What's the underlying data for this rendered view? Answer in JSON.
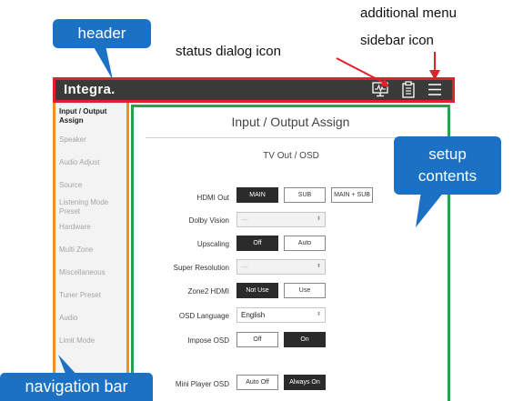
{
  "annotations": {
    "header": "header",
    "status_dialog_icon": "status dialog icon",
    "additional_menu_line1": "additional menu",
    "additional_menu_line2": "sidebar icon",
    "setup_line1": "setup",
    "setup_line2": "contents",
    "navigation_bar": "navigation bar"
  },
  "app": {
    "logo": "Integra."
  },
  "sidebar": {
    "items": [
      {
        "label": "Input / Output Assign",
        "active": true
      },
      {
        "label": "Speaker"
      },
      {
        "label": "Audio Adjust"
      },
      {
        "label": "Source"
      },
      {
        "label": "Listening Mode Preset"
      },
      {
        "label": "Hardware"
      },
      {
        "label": "Multi Zone"
      },
      {
        "label": "Miscellaneous"
      },
      {
        "label": "Tuner Preset"
      },
      {
        "label": "Audio"
      },
      {
        "label": "Limit Mode"
      }
    ]
  },
  "main": {
    "title": "Input / Output Assign",
    "section": "TV Out / OSD",
    "rows": {
      "hdmi_out": {
        "label": "HDMI Out",
        "options": [
          "MAIN",
          "SUB",
          "MAIN + SUB"
        ],
        "selected": "MAIN"
      },
      "dolby_vision": {
        "label": "Dolby Vision",
        "value": "---"
      },
      "upscaling": {
        "label": "Upscaling",
        "options": [
          "Off",
          "Auto"
        ],
        "selected": "Off"
      },
      "super_resolution": {
        "label": "Super Resolution",
        "value": "---"
      },
      "zone2_hdmi": {
        "label": "Zone2 HDMI",
        "options": [
          "Not Use",
          "Use"
        ],
        "selected": "Not Use"
      },
      "osd_language": {
        "label": "OSD Language",
        "value": "English"
      },
      "impose_osd": {
        "label": "Impose OSD",
        "options": [
          "Off",
          "On"
        ],
        "selected": "On"
      },
      "mini_player_osd": {
        "label": "Mini Player OSD",
        "options": [
          "Auto Off",
          "Always On"
        ],
        "selected": "Always On"
      }
    }
  },
  "colors": {
    "header_outline": "#e0202a",
    "sidebar_outline": "#f0901e",
    "content_outline": "#27a14e",
    "callout_blue": "#1b72c4",
    "selected_button": "#2b2b2b"
  },
  "icons": [
    "status-dialog-icon",
    "clipboard-icon",
    "hamburger-menu-icon"
  ]
}
